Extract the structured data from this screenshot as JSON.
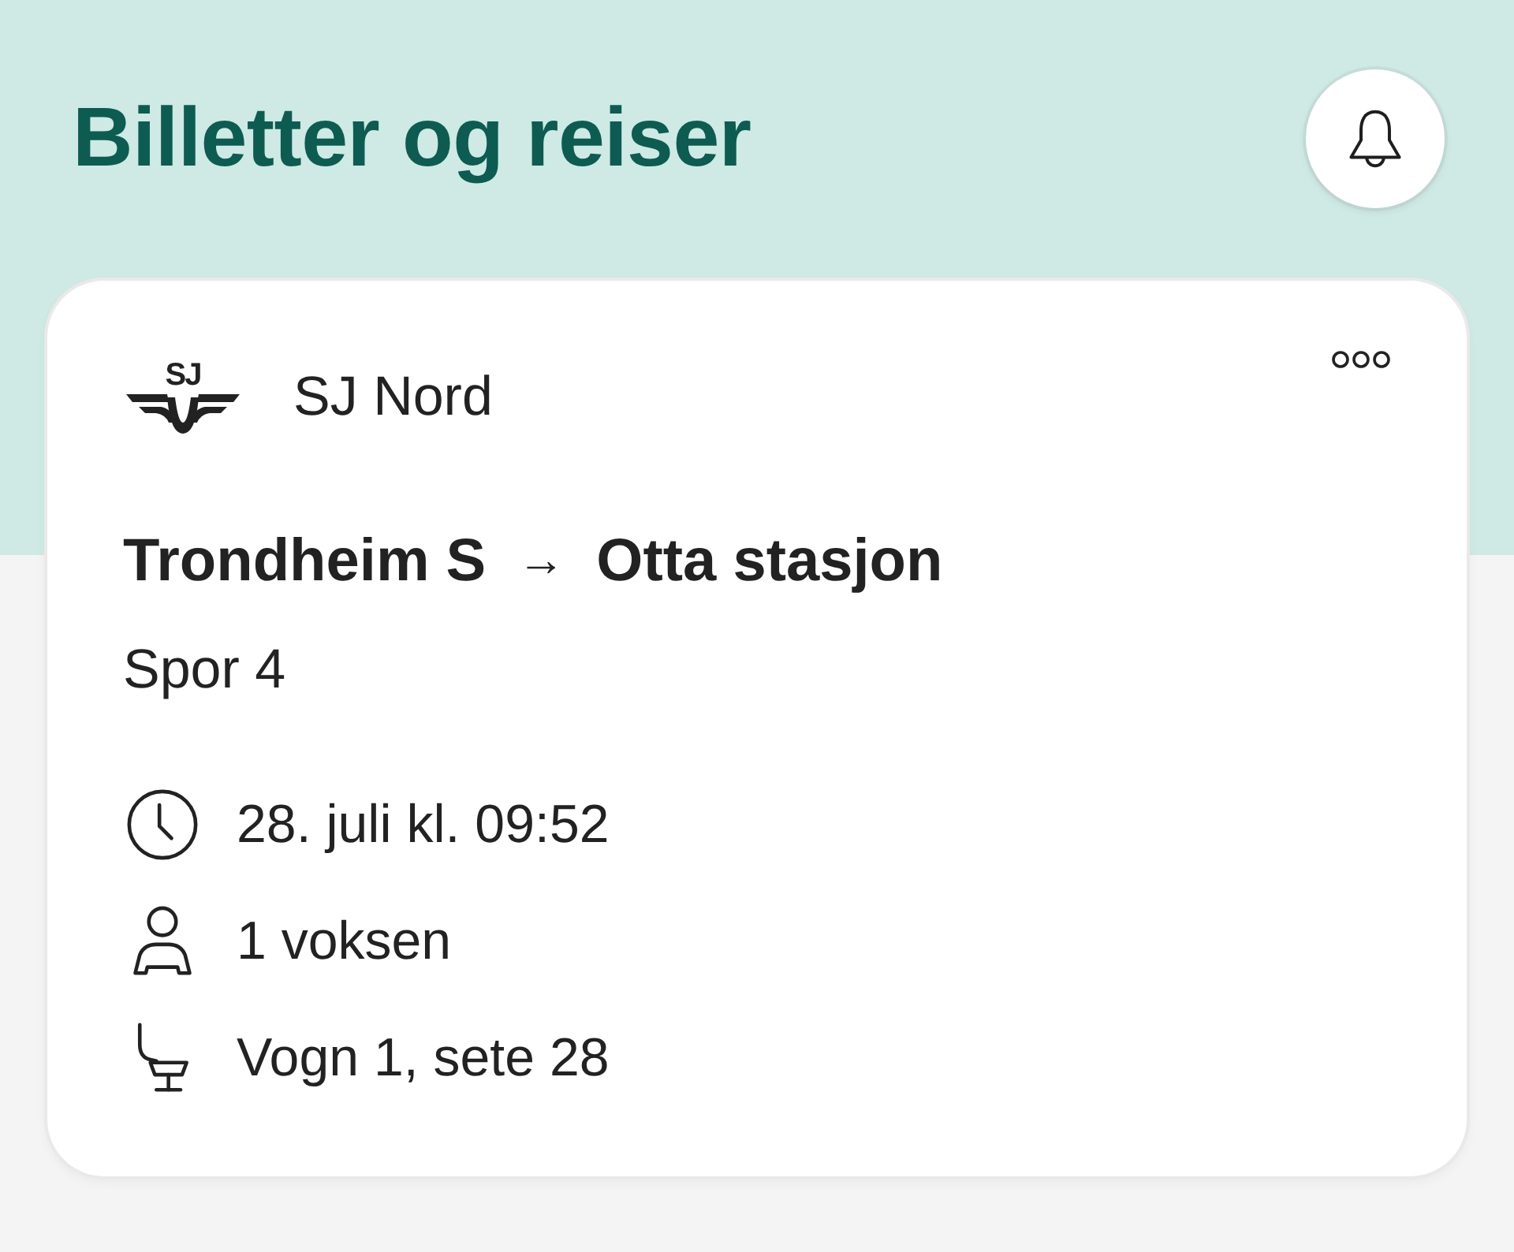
{
  "header": {
    "title": "Billetter og reiser"
  },
  "ticket": {
    "operator": {
      "logo_text": "SJ",
      "name": "SJ Nord"
    },
    "route": {
      "from": "Trondheim S",
      "arrow": "→",
      "to": "Otta stasjon"
    },
    "platform": "Spor 4",
    "details": [
      {
        "kind": "time",
        "text": "28. juli kl. 09:52"
      },
      {
        "kind": "passengers",
        "text": "1 voksen"
      },
      {
        "kind": "seat",
        "text": "Vogn 1, sete 28"
      }
    ]
  }
}
